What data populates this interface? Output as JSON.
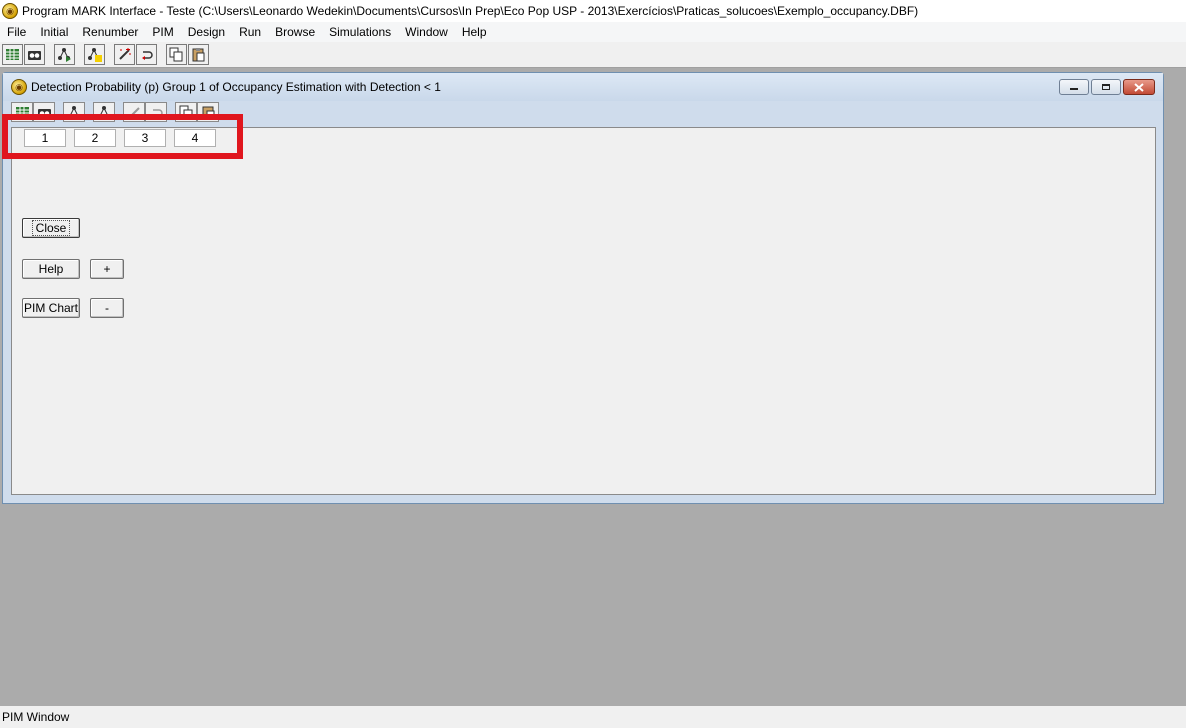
{
  "app": {
    "title": "Program MARK Interface - Teste  (C:\\Users\\Leonardo Wedekin\\Documents\\Cursos\\In Prep\\Eco Pop USP - 2013\\Exercícios\\Praticas_solucoes\\Exemplo_occupancy.DBF)"
  },
  "menu": {
    "items": [
      "File",
      "Initial",
      "Renumber",
      "PIM",
      "Design",
      "Run",
      "Browse",
      "Simulations",
      "Window",
      "Help"
    ]
  },
  "child": {
    "title": "Detection Probability (p) Group 1 of Occupancy Estimation with Detection < 1",
    "occasions": [
      "1",
      "2",
      "3",
      "4"
    ],
    "buttons": {
      "close": "Close",
      "help": "Help",
      "plus": "+",
      "pim_chart": "PIM Chart",
      "minus": "-"
    }
  },
  "status": {
    "text": "PIM Window"
  },
  "colors": {
    "highlight": "#e0161e"
  }
}
